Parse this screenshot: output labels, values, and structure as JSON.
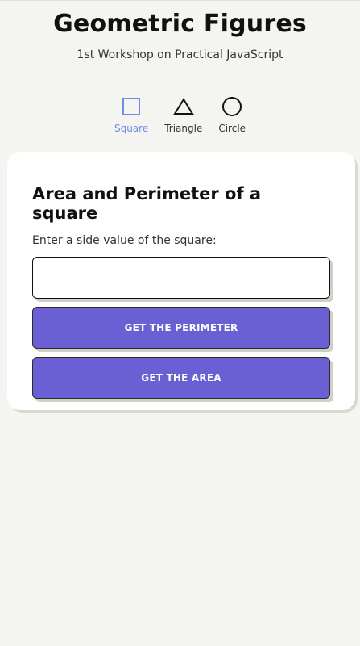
{
  "header": {
    "title": "Geometric Figures",
    "subtitle": "1st Workshop on Practical JavaScript"
  },
  "nav": {
    "items": [
      {
        "label": "Square",
        "icon": "square-icon",
        "active": true
      },
      {
        "label": "Triangle",
        "icon": "triangle-icon",
        "active": false
      },
      {
        "label": "Circle",
        "icon": "circle-icon",
        "active": false
      }
    ]
  },
  "card": {
    "title": "Area and Perimeter of a square",
    "input_label": "Enter a side value of the square:",
    "input_value": "",
    "input_placeholder": "",
    "perimeter_button": "GET THE PERIMETER",
    "area_button": "GET THE AREA"
  },
  "colors": {
    "background": "#f4f4f0",
    "accent": "#6a5fd3",
    "active_nav": "#6d8fe6"
  }
}
